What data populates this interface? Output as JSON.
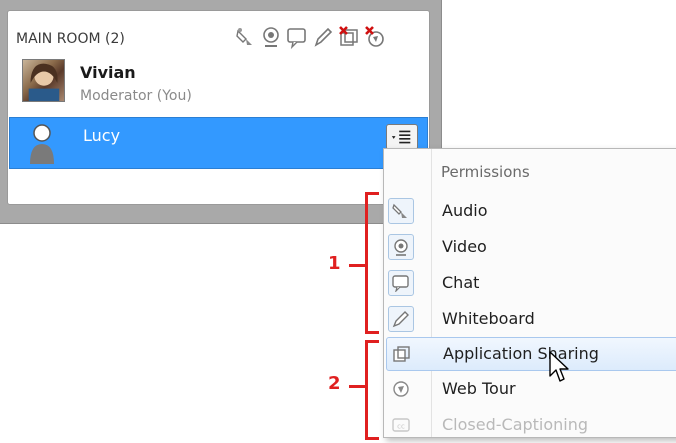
{
  "room": {
    "title": "MAIN ROOM (2)",
    "icons": [
      "audio-icon",
      "video-icon",
      "chat-icon",
      "whiteboard-icon",
      "app-sharing-disabled-icon",
      "web-tour-disabled-icon"
    ],
    "users": [
      {
        "name": "Vivian",
        "role": "Moderator (You)",
        "avatar": "photo"
      },
      {
        "name": "Lucy",
        "avatar": "default-user-icon",
        "selected": true
      }
    ]
  },
  "menu": {
    "header": "Permissions",
    "items": [
      {
        "label": "Audio",
        "icon": "audio-icon"
      },
      {
        "label": "Video",
        "icon": "video-icon"
      },
      {
        "label": "Chat",
        "icon": "chat-icon"
      },
      {
        "label": "Whiteboard",
        "icon": "whiteboard-icon"
      },
      {
        "label": "Application Sharing",
        "icon": "app-sharing-icon",
        "hover": true
      },
      {
        "label": "Web Tour",
        "icon": "web-tour-icon"
      },
      {
        "label": "Closed-Captioning",
        "icon": "cc-icon",
        "disabled": true
      }
    ]
  },
  "annotations": {
    "one": "1",
    "two": "2"
  },
  "colors": {
    "selection": "#3399ff",
    "annotation": "#e02020"
  }
}
